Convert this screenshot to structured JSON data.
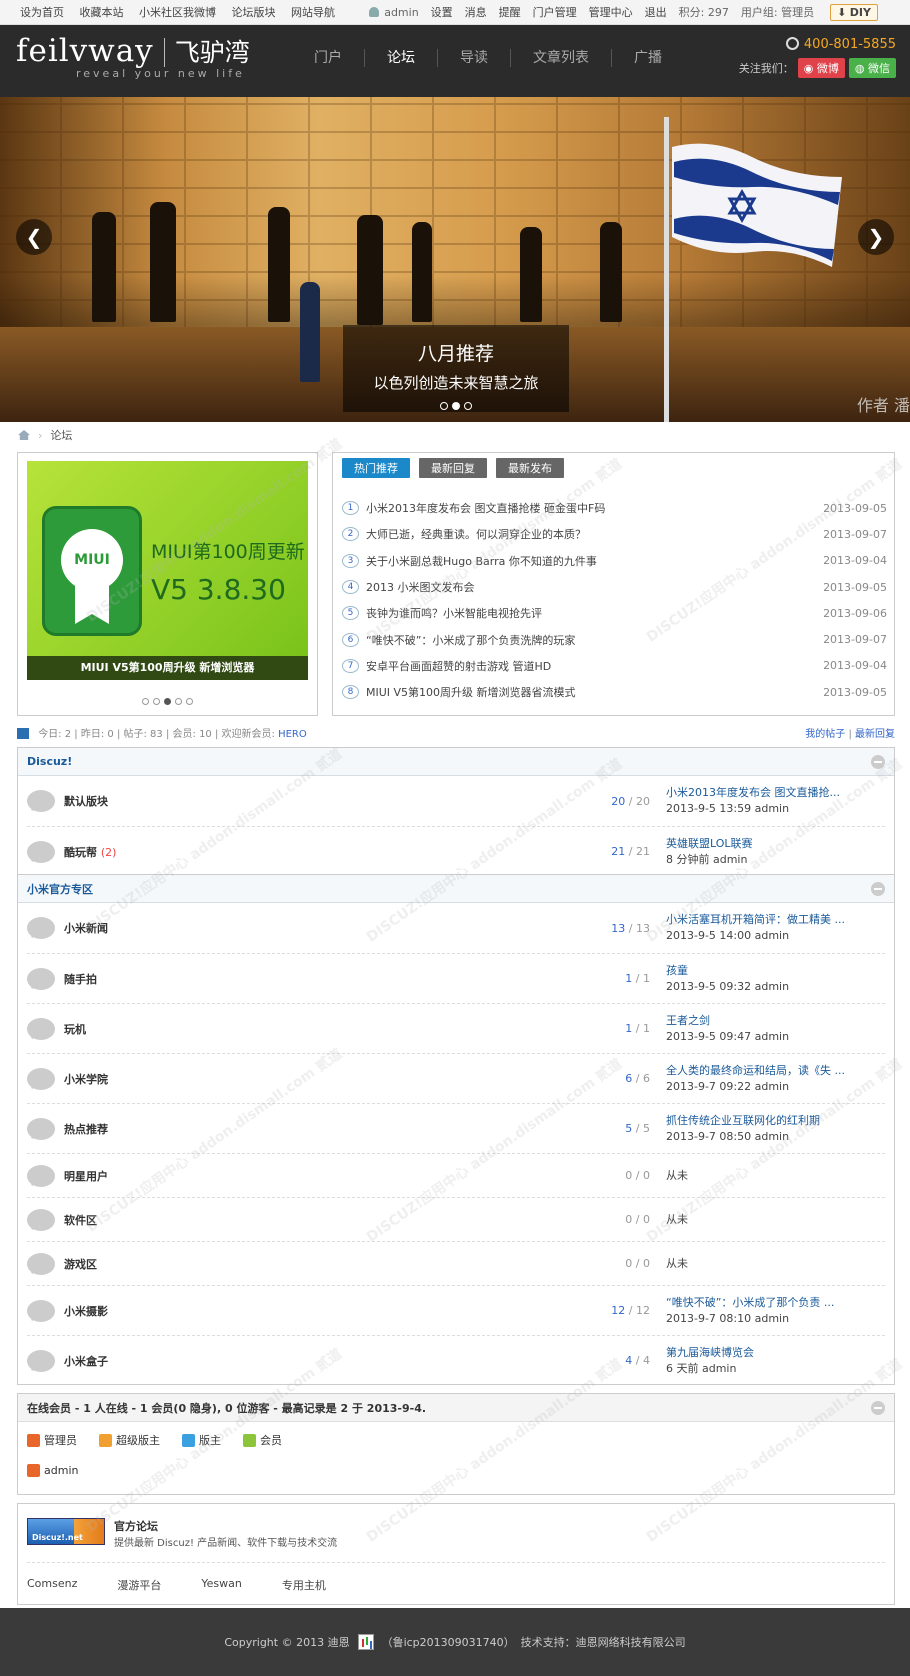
{
  "topbar": {
    "links": [
      "设为首页",
      "收藏本站",
      "小米社区我微博",
      "论坛版块",
      "网站导航"
    ],
    "username": "admin",
    "user_links": [
      "设置",
      "消息",
      "提醒",
      "门户管理",
      "管理中心",
      "退出"
    ],
    "points": "积分: 297",
    "group": "用户组: 管理员",
    "diy": "DIY"
  },
  "header": {
    "logo_en": "feilvway",
    "logo_cn": "飞驴湾",
    "slogan": "reveal your new life",
    "nav": [
      "门户",
      "论坛",
      "导读",
      "文章列表",
      "广播"
    ],
    "active_nav": "论坛",
    "phone": "400-801-5855",
    "follow_label": "关注我们：",
    "weibo": "微博",
    "wechat": "微信"
  },
  "banner": {
    "title": "八月推荐",
    "subtitle": "以色列创造未来智慧之旅",
    "author_mark": "作者 潘",
    "slides": 3,
    "active_slide": 2
  },
  "breadcrumb": {
    "current": "论坛"
  },
  "slider": {
    "badge_text": "MIUI",
    "line1": "MIUI第100周更新",
    "line2": "V5 3.8.30",
    "caption": "MIUI V5第100周升级 新增浏览器",
    "dots": 5,
    "active_dot": 3
  },
  "hot": {
    "tabs": [
      "热门推荐",
      "最新回复",
      "最新发布"
    ],
    "active_tab": "热门推荐",
    "items": [
      {
        "num": "1",
        "title": "小米2013年度发布会 图文直播抢楼 砸金蛋中F码",
        "date": "2013-09-05"
      },
      {
        "num": "2",
        "title": "大师已逝，经典重读。何以洞穿企业的本质？",
        "date": "2013-09-07"
      },
      {
        "num": "3",
        "title": "关于小米副总裁Hugo Barra 你不知道的九件事",
        "date": "2013-09-04"
      },
      {
        "num": "4",
        "title": "2013 小米图文发布会",
        "date": "2013-09-05"
      },
      {
        "num": "5",
        "title": "丧钟为谁而鸣？小米智能电视抢先评",
        "date": "2013-09-06"
      },
      {
        "num": "6",
        "title": "“唯快不破”：小米成了那个负责洗牌的玩家",
        "date": "2013-09-07"
      },
      {
        "num": "7",
        "title": "安卓平台画面超赞的射击游戏 管道HD",
        "date": "2013-09-04"
      },
      {
        "num": "8",
        "title": "MIUI V5第100周升级 新增浏览器省流模式",
        "date": "2013-09-05"
      }
    ]
  },
  "stats": {
    "today": "今日: 2",
    "yesterday": "昨日: 0",
    "posts": "帖子: 83",
    "members": "会员: 10",
    "welcome": "欢迎新会员:",
    "newest": "HERO",
    "my_posts": "我的帖子",
    "latest_reply": "最新回复"
  },
  "groups": [
    {
      "title": "Discuz!",
      "forums": [
        {
          "name": "默认版块",
          "today": "",
          "threads": "20",
          "posts": "20",
          "last_title": "小米2013年度发布会 图文直播抢...",
          "last_meta": "2013-9-5 13:59 admin"
        },
        {
          "name": "酷玩帮",
          "today": "(2)",
          "threads": "21",
          "posts": "21",
          "last_title": "英雄联盟LOL联赛",
          "last_meta": "8 分钟前 admin"
        }
      ]
    },
    {
      "title": "小米官方专区",
      "forums": [
        {
          "name": "小米新闻",
          "today": "",
          "threads": "13",
          "posts": "13",
          "last_title": "小米活塞耳机开箱简评：做工精美 ...",
          "last_meta": "2013-9-5 14:00 admin"
        },
        {
          "name": "随手拍",
          "today": "",
          "threads": "1",
          "posts": "1",
          "last_title": "孩童",
          "last_meta": "2013-9-5 09:32 admin"
        },
        {
          "name": "玩机",
          "today": "",
          "threads": "1",
          "posts": "1",
          "last_title": "王者之剑",
          "last_meta": "2013-9-5 09:47 admin"
        },
        {
          "name": "小米学院",
          "today": "",
          "threads": "6",
          "posts": "6",
          "last_title": "全人类的最终命运和结局，读《失 ...",
          "last_meta": "2013-9-7 09:22 admin"
        },
        {
          "name": "热点推荐",
          "today": "",
          "threads": "5",
          "posts": "5",
          "last_title": "抓住传统企业互联网化的红利期",
          "last_meta": "2013-9-7 08:50 admin"
        },
        {
          "name": "明星用户",
          "today": "",
          "threads": "0",
          "posts": "0",
          "last_title": "",
          "last_meta": "",
          "never": "从未"
        },
        {
          "name": "软件区",
          "today": "",
          "threads": "0",
          "posts": "0",
          "last_title": "",
          "last_meta": "",
          "never": "从未"
        },
        {
          "name": "游戏区",
          "today": "",
          "threads": "0",
          "posts": "0",
          "last_title": "",
          "last_meta": "",
          "never": "从未"
        },
        {
          "name": "小米摄影",
          "today": "",
          "threads": "12",
          "posts": "12",
          "last_title": "“唯快不破”：小米成了那个负责 ...",
          "last_meta": "2013-9-7 08:10 admin"
        },
        {
          "name": "小米盒子",
          "today": "",
          "threads": "4",
          "posts": "4",
          "last_title": "第九届海峡博览会",
          "last_meta": "6 天前 admin"
        }
      ]
    }
  ],
  "online": {
    "summary": "在线会员 - 1 人在线 - 1 会员(0 隐身), 0 位游客 - 最高记录是 2 于 2013-9-4.",
    "legend": [
      {
        "label": "管理员",
        "color": "#e8662a"
      },
      {
        "label": "超级版主",
        "color": "#f0a030"
      },
      {
        "label": "版主",
        "color": "#3aa0e0"
      },
      {
        "label": "会员",
        "color": "#8cc43a"
      }
    ],
    "user": "admin"
  },
  "links": {
    "logo_text": "Discuz!.net",
    "title": "官方论坛",
    "desc": "提供最新 Discuz! 产品新闻、软件下载与技术交流",
    "text_links": [
      "Comsenz",
      "漫游平台",
      "Yeswan",
      "专用主机"
    ]
  },
  "footer": {
    "copyright": "Copyright © 2013 迪恩",
    "icp": "（鲁icp201309031740）",
    "support": "技术支持：迪恩网络科技有限公司"
  },
  "watermark": "DISCUZ!应用中心 addon.dismall.com 贰道"
}
